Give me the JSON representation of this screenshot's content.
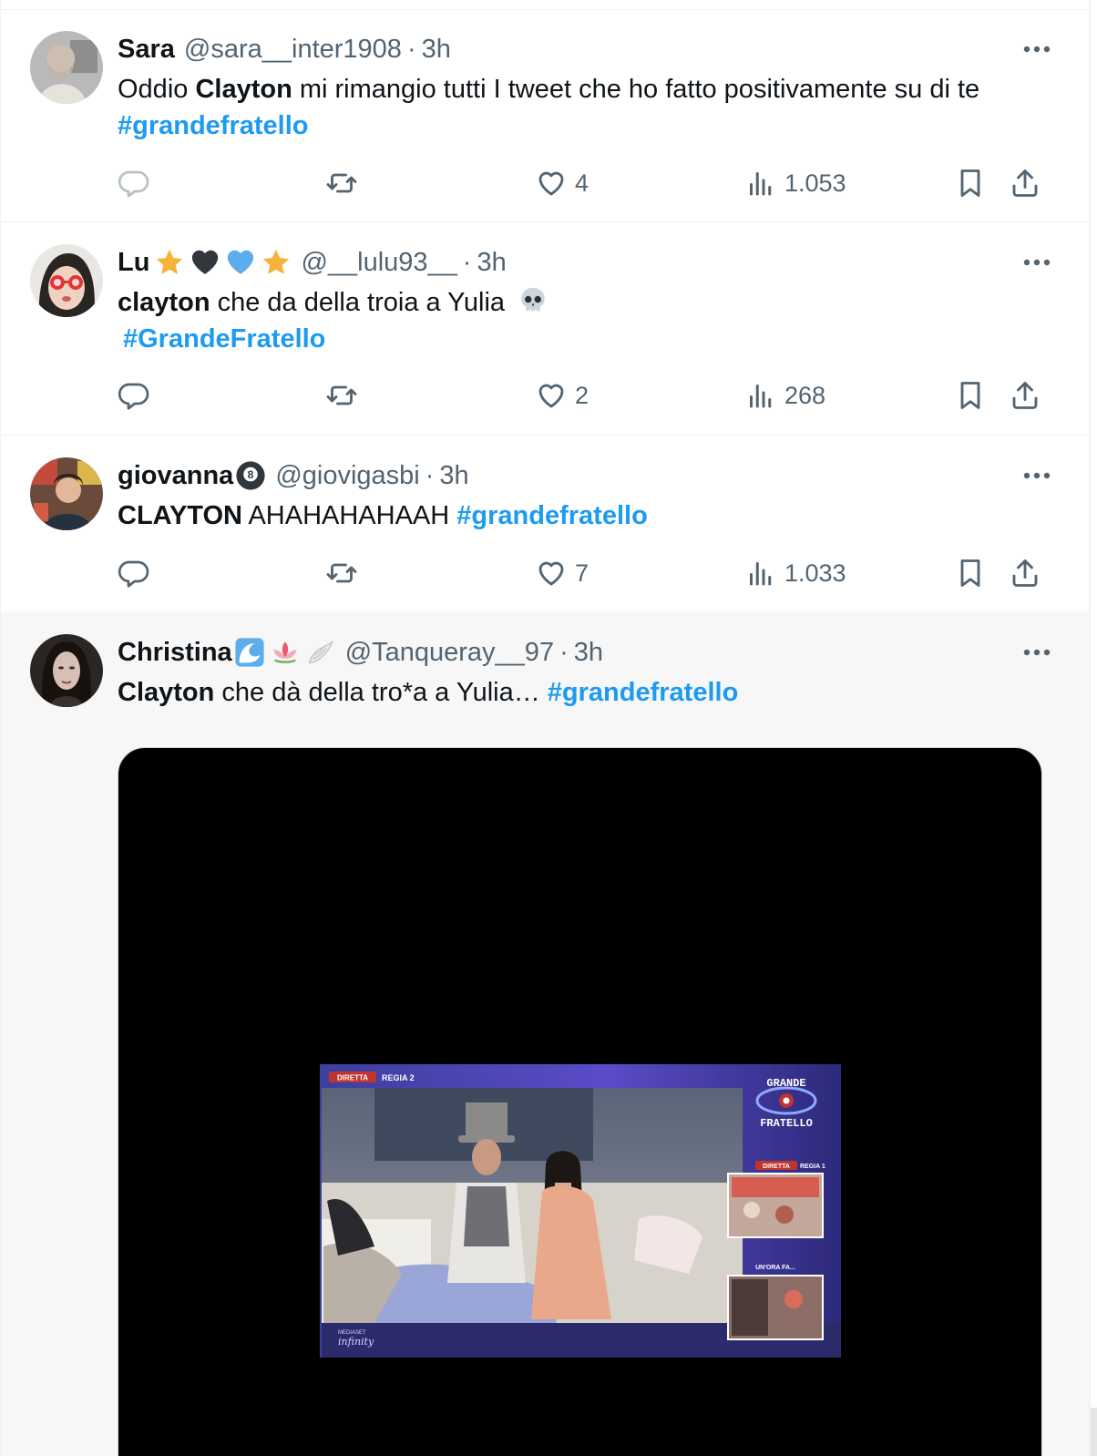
{
  "tweets": [
    {
      "name": "Sara",
      "handle": "@sara__inter1908",
      "dot": "·",
      "time": "3h",
      "text_parts": [
        "Oddio ",
        "Clayton",
        " mi rimangio tutti I tweet che ho fatto positivamente su di te"
      ],
      "hashtag": "#grandefratello",
      "likes": "4",
      "views": "1.053"
    },
    {
      "name": "Lu",
      "handle": "@__lulu93__",
      "dot": "·",
      "time": "3h",
      "text_parts": [
        "clayton",
        " che da della troia a Yulia"
      ],
      "hashtag": "#GrandeFratello",
      "likes": "2",
      "views": "268"
    },
    {
      "name": "giovanna",
      "handle": "@giovigasbi",
      "dot": "·",
      "time": "3h",
      "text_parts": [
        "CLAYTON",
        " AHAHAHAHAAH "
      ],
      "hashtag": "#grandefratello",
      "likes": "7",
      "views": "1.033"
    },
    {
      "name": "Christina",
      "handle": "@Tanqueray__97",
      "dot": "·",
      "time": "3h",
      "text_parts": [
        "Clayton",
        " che dà della tro*a a Yulia… "
      ],
      "hashtag": "#grandefratello"
    }
  ],
  "video": {
    "live_label": "DIRETTA",
    "regia2": "REGIA 2",
    "regia1": "REGIA 1",
    "logo_line1": "GRANDE",
    "logo_line2": "FRATELLO",
    "unora": "UN'ORA FA...",
    "mediaset": "MEDIASET",
    "infinity": "infinity"
  },
  "icons": {
    "reply": "reply-icon",
    "retweet": "retweet-icon",
    "like": "like-icon",
    "views": "views-icon",
    "bookmark": "bookmark-icon",
    "share": "share-icon",
    "more": "more-icon"
  },
  "colors": {
    "hashtag": "#1d9bf0",
    "secondary_text": "#536471",
    "primary_text": "#0f1419"
  }
}
